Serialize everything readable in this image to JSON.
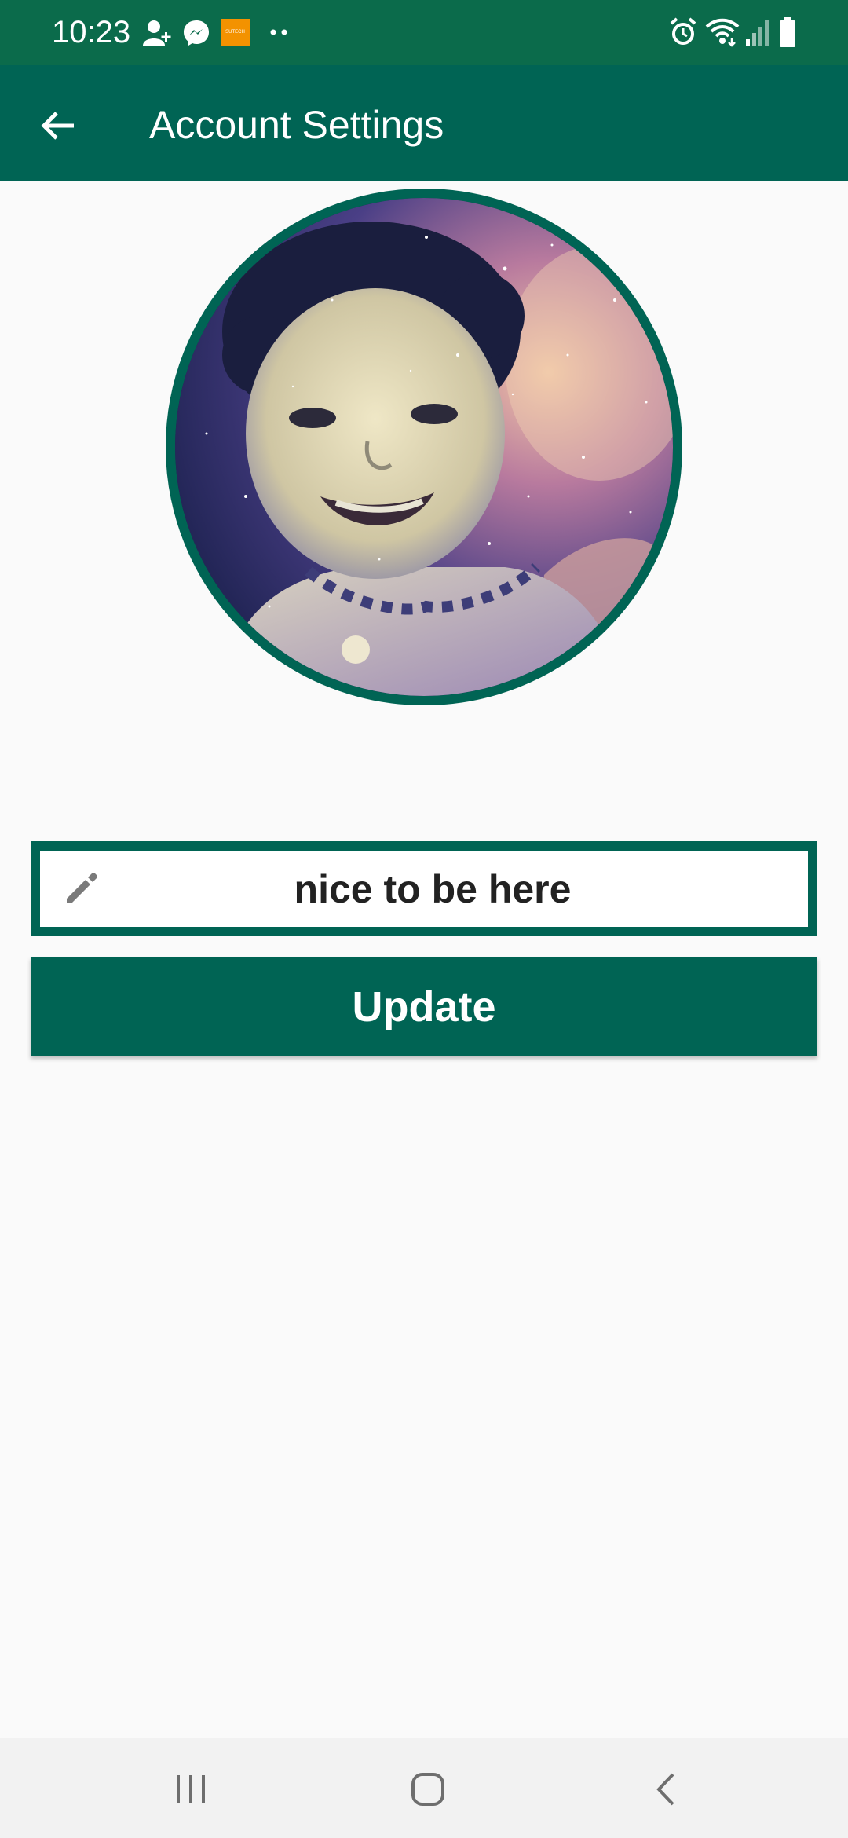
{
  "status_bar": {
    "time": "10:23",
    "notification_icons": [
      "person-add-icon",
      "messenger-icon",
      "app-badge-icon",
      "more-dots-icon"
    ],
    "badge_label": "SUTECH",
    "system_icons": [
      "alarm-icon",
      "wifi-icon",
      "signal-icon",
      "battery-icon"
    ]
  },
  "app_bar": {
    "title": "Account Settings",
    "back_icon": "arrow-left-icon"
  },
  "profile": {
    "avatar_description_icon": "profile-photo"
  },
  "status_field": {
    "value": "nice to be here",
    "icon": "pencil-icon"
  },
  "update_button": {
    "label": "Update"
  },
  "nav_bar": {
    "items": [
      "recent-apps-icon",
      "home-icon",
      "back-icon"
    ]
  },
  "colors": {
    "status_bar": "#0b6b4b",
    "primary": "#006454",
    "background": "#fafafa",
    "text_dark": "#222222"
  }
}
